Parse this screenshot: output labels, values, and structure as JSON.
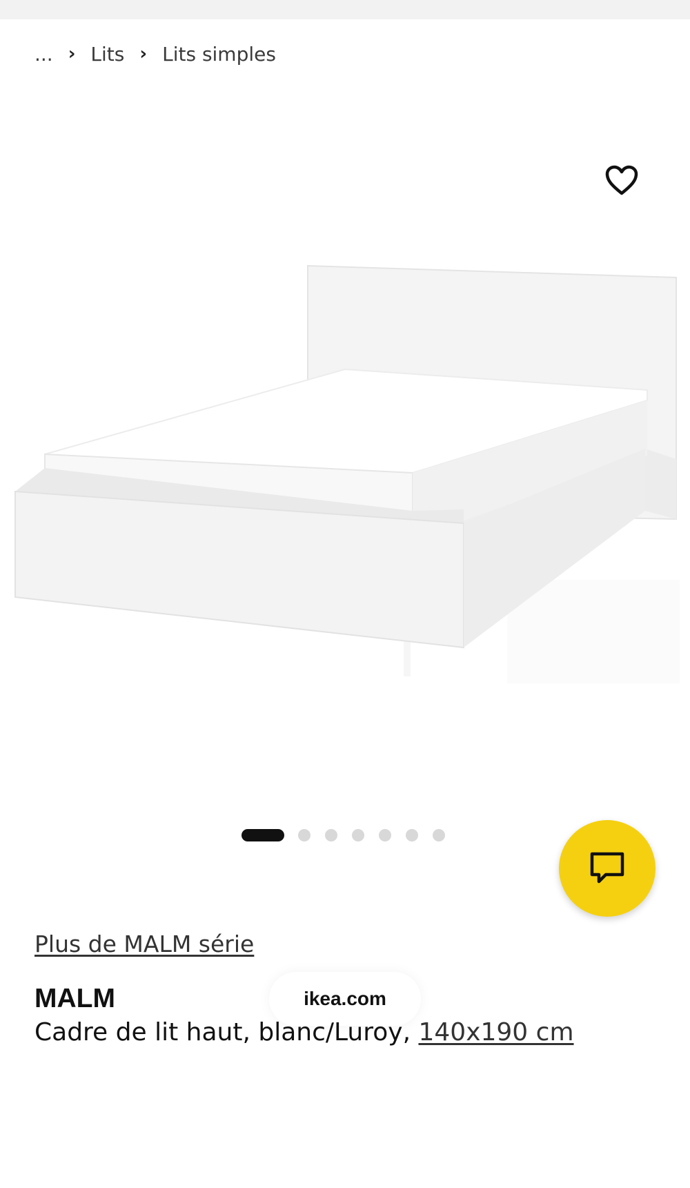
{
  "breadcrumb": {
    "ellipsis": "...",
    "items": [
      "Lits",
      "Lits simples"
    ]
  },
  "icons": {
    "favorite": "heart-outline-icon",
    "chat": "chat-bubble-icon",
    "separator": "chevron-right-icon"
  },
  "gallery": {
    "total_images": 7,
    "active_index": 0
  },
  "product": {
    "series_link": "Plus de MALM série",
    "name": "MALM",
    "description": "Cadre de lit haut, blanc/Luroy, ",
    "size": "140x190 cm"
  },
  "overlay": {
    "domain": "ikea.com"
  },
  "colors": {
    "accent_yellow": "#f5d010",
    "text": "#111111",
    "dot_inactive": "#d8d8d8",
    "dot_active": "#111111"
  }
}
